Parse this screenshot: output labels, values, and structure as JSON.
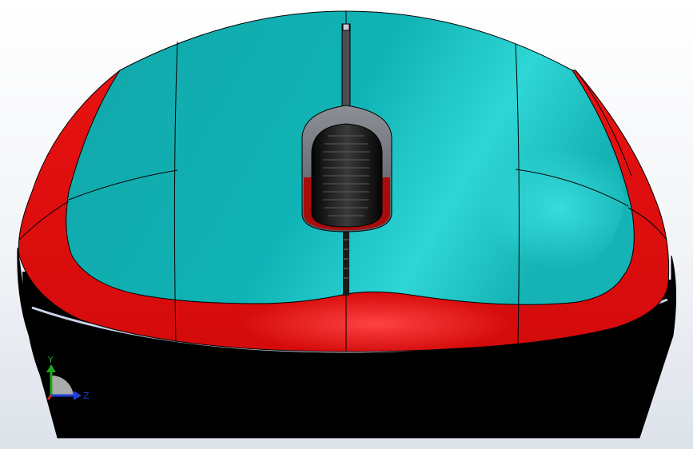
{
  "viewport": {
    "background": [
      "#ffffff",
      "#dde2ea"
    ],
    "model": {
      "name": "computer mouse",
      "colors": {
        "shell": "#13b9bb",
        "shell_highlight": "#35dcdc",
        "rim": "#e01010",
        "rim_highlight": "#ff3b3b",
        "base": "#000000",
        "wheel_housing": "#6c6f76",
        "wheel": "#1b1b1b",
        "wheel_red": "#a80d0d"
      }
    },
    "triad": {
      "icon": "coordinate-triad-icon",
      "axis_y": "Y",
      "axis_z": "Z",
      "colors": {
        "y": "#1fa51f",
        "z": "#1f3fd6",
        "x": "#d62020"
      }
    }
  }
}
